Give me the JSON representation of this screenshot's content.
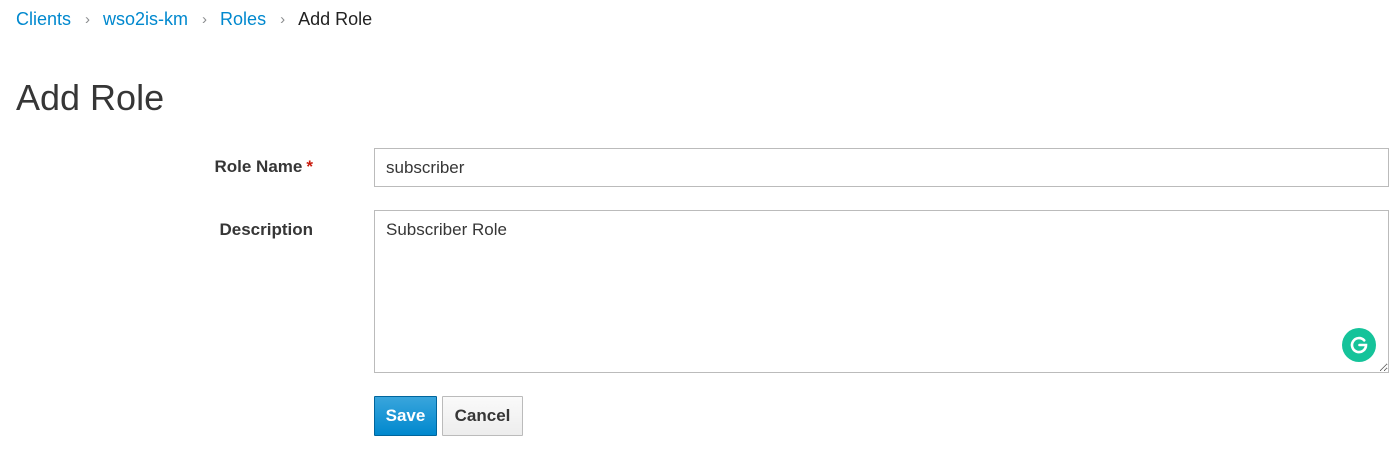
{
  "breadcrumb": {
    "items": [
      {
        "label": "Clients"
      },
      {
        "label": "wso2is-km"
      },
      {
        "label": "Roles"
      }
    ],
    "separator": "›",
    "current": "Add Role"
  },
  "page": {
    "title": "Add Role"
  },
  "form": {
    "role_name": {
      "label": "Role Name",
      "required_marker": "*",
      "value": "subscriber"
    },
    "description": {
      "label": "Description",
      "value": "Subscriber Role"
    }
  },
  "actions": {
    "save_label": "Save",
    "cancel_label": "Cancel"
  },
  "colors": {
    "link": "#0088ce",
    "primary": "#0088ce",
    "required": "#c9190b",
    "grammarly": "#15c39a"
  },
  "icons": {
    "grammarly": "grammarly-icon",
    "separator": "chevron-right-icon"
  }
}
